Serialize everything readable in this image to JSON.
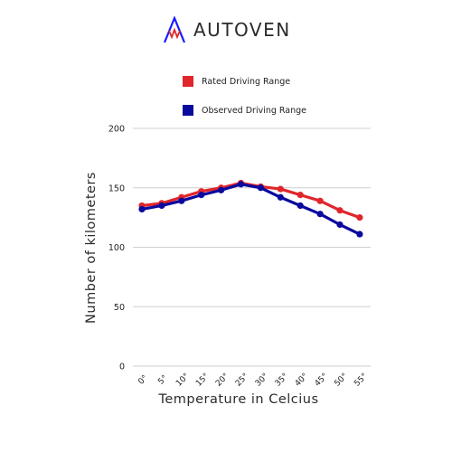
{
  "brand": {
    "name": "AUTOVEN",
    "colors": {
      "logo_red": "#e0262b",
      "logo_blue": "#1a1aff"
    }
  },
  "chart_data": {
    "type": "line",
    "title": "",
    "xlabel": "Temperature in Celcius",
    "ylabel": "Number of kilometers",
    "categories": [
      "0°",
      "5°",
      "10°",
      "15°",
      "20°",
      "25°",
      "30°",
      "35°",
      "40°",
      "45°",
      "50°",
      "55°"
    ],
    "ylim": [
      0,
      200
    ],
    "yticks": [
      0,
      50,
      100,
      150,
      200
    ],
    "grid": true,
    "legend_position": "top",
    "series": [
      {
        "name": "Rated Driving Range",
        "color": "#e0262b",
        "values": [
          135,
          137,
          142,
          147,
          150,
          154,
          151,
          149,
          144,
          139,
          131,
          125
        ]
      },
      {
        "name": "Observed Driving Range",
        "color": "#0a0a9e",
        "values": [
          132,
          135,
          139,
          144,
          148,
          153,
          150,
          142,
          135,
          128,
          119,
          111
        ]
      }
    ]
  }
}
